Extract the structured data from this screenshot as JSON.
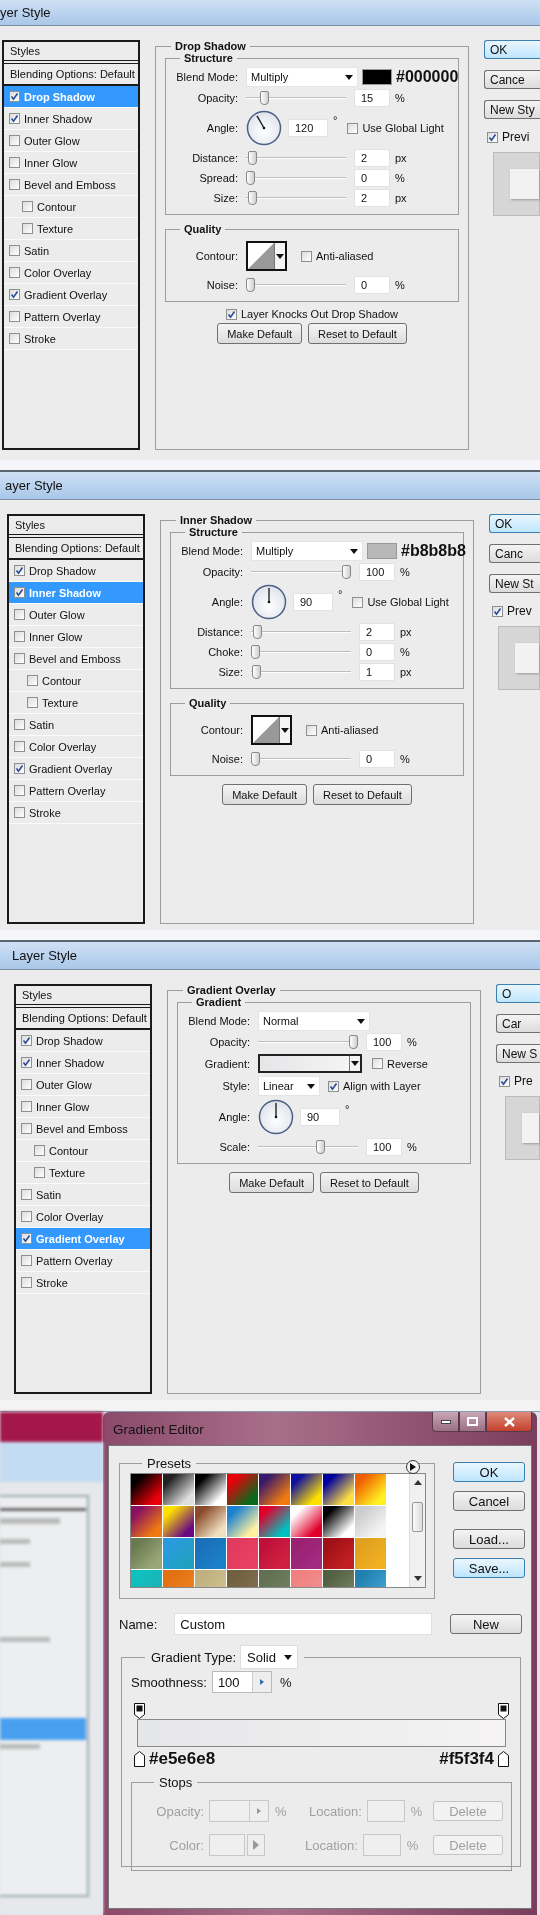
{
  "layer_style_dialogs": [
    {
      "title": "yer Style",
      "styles_list": [
        {
          "kind": "header",
          "label": "Styles",
          "selected": false
        },
        {
          "kind": "option",
          "label": "Blending Options: Default",
          "selected": false
        },
        {
          "kind": "effect",
          "label": "Drop Shadow",
          "checked": true,
          "selected": true
        },
        {
          "kind": "effect",
          "label": "Inner Shadow",
          "checked": true,
          "selected": false
        },
        {
          "kind": "effect",
          "label": "Outer Glow",
          "checked": false,
          "selected": false
        },
        {
          "kind": "effect",
          "label": "Inner Glow",
          "checked": false,
          "selected": false
        },
        {
          "kind": "effect",
          "label": "Bevel and Emboss",
          "checked": false,
          "selected": false,
          "children": [
            {
              "kind": "effect",
              "label": "Contour",
              "checked": false,
              "selected": false
            },
            {
              "kind": "effect",
              "label": "Texture",
              "checked": false,
              "selected": false
            }
          ]
        },
        {
          "kind": "effect",
          "label": "Satin",
          "checked": false,
          "selected": false
        },
        {
          "kind": "effect",
          "label": "Color Overlay",
          "checked": false,
          "selected": false
        },
        {
          "kind": "effect",
          "label": "Gradient Overlay",
          "checked": true,
          "selected": false
        },
        {
          "kind": "effect",
          "label": "Pattern Overlay",
          "checked": false,
          "selected": false
        },
        {
          "kind": "effect",
          "label": "Stroke",
          "checked": false,
          "selected": false
        }
      ],
      "panel": {
        "title": "Drop Shadow",
        "groups": [
          {
            "title": "Structure",
            "rows": [
              {
                "kind": "select",
                "label": "Blend Mode:",
                "value": "Multiply",
                "swatch": {
                  "color": "#000000",
                  "hex": "#000000"
                }
              },
              {
                "kind": "slider",
                "label": "Opacity:",
                "level": 0.15,
                "value": "15",
                "unit": "%"
              },
              {
                "kind": "angle",
                "label": "Angle:",
                "value": "120",
                "unit": "°",
                "checkbox": {
                  "label": "Use Global Light",
                  "checked": false
                }
              },
              {
                "kind": "slider",
                "label": "Distance:",
                "level": 0.02,
                "value": "2",
                "unit": "px"
              },
              {
                "kind": "slider",
                "label": "Spread:",
                "level": 0,
                "value": "0",
                "unit": "%"
              },
              {
                "kind": "slider",
                "label": "Size:",
                "level": 0.02,
                "value": "2",
                "unit": "px"
              }
            ]
          },
          {
            "title": "Quality",
            "rows": [
              {
                "kind": "contour",
                "label": "Contour:",
                "checkbox": {
                  "label": "Anti-aliased",
                  "checked": false
                }
              },
              {
                "kind": "slider",
                "label": "Noise:",
                "level": 0,
                "value": "0",
                "unit": "%"
              }
            ]
          }
        ],
        "extra_checkbox": {
          "label": "Layer Knocks Out Drop Shadow",
          "checked": true
        },
        "buttons": [
          "Make Default",
          "Reset to Default"
        ]
      },
      "side_buttons": [
        {
          "label": "OK",
          "focused": true
        },
        {
          "label": "Cance",
          "focused": false
        },
        {
          "label": "New Sty",
          "focused": false
        }
      ],
      "preview": {
        "label": "Previ",
        "checked": true
      }
    },
    {
      "title": "ayer Style",
      "styles_list": [
        {
          "kind": "header",
          "label": "Styles",
          "selected": false
        },
        {
          "kind": "option",
          "label": "Blending Options: Default",
          "selected": false
        },
        {
          "kind": "effect",
          "label": "Drop Shadow",
          "checked": true,
          "selected": false
        },
        {
          "kind": "effect",
          "label": "Inner Shadow",
          "checked": true,
          "selected": true
        },
        {
          "kind": "effect",
          "label": "Outer Glow",
          "checked": false,
          "selected": false
        },
        {
          "kind": "effect",
          "label": "Inner Glow",
          "checked": false,
          "selected": false
        },
        {
          "kind": "effect",
          "label": "Bevel and Emboss",
          "checked": false,
          "selected": false,
          "children": [
            {
              "kind": "effect",
              "label": "Contour",
              "checked": false,
              "selected": false
            },
            {
              "kind": "effect",
              "label": "Texture",
              "checked": false,
              "selected": false
            }
          ]
        },
        {
          "kind": "effect",
          "label": "Satin",
          "checked": false,
          "selected": false
        },
        {
          "kind": "effect",
          "label": "Color Overlay",
          "checked": false,
          "selected": false
        },
        {
          "kind": "effect",
          "label": "Gradient Overlay",
          "checked": true,
          "selected": false
        },
        {
          "kind": "effect",
          "label": "Pattern Overlay",
          "checked": false,
          "selected": false
        },
        {
          "kind": "effect",
          "label": "Stroke",
          "checked": false,
          "selected": false
        }
      ],
      "panel": {
        "title": "Inner Shadow",
        "groups": [
          {
            "title": "Structure",
            "rows": [
              {
                "kind": "select",
                "label": "Blend Mode:",
                "value": "Multiply",
                "swatch": {
                  "color": "#b8b8b8",
                  "hex": "#b8b8b8"
                }
              },
              {
                "kind": "slider",
                "label": "Opacity:",
                "level": 1,
                "value": "100",
                "unit": "%"
              },
              {
                "kind": "angle",
                "label": "Angle:",
                "value": "90",
                "unit": "°",
                "checkbox": {
                  "label": "Use Global Light",
                  "checked": false
                }
              },
              {
                "kind": "slider",
                "label": "Distance:",
                "level": 0.02,
                "value": "2",
                "unit": "px"
              },
              {
                "kind": "slider",
                "label": "Choke:",
                "level": 0,
                "value": "0",
                "unit": "%"
              },
              {
                "kind": "slider",
                "label": "Size:",
                "level": 0.01,
                "value": "1",
                "unit": "px"
              }
            ]
          },
          {
            "title": "Quality",
            "rows": [
              {
                "kind": "contour",
                "label": "Contour:",
                "checkbox": {
                  "label": "Anti-aliased",
                  "checked": false
                }
              },
              {
                "kind": "slider",
                "label": "Noise:",
                "level": 0,
                "value": "0",
                "unit": "%"
              }
            ]
          }
        ],
        "buttons": [
          "Make Default",
          "Reset to Default"
        ]
      },
      "side_buttons": [
        {
          "label": "OK",
          "focused": true
        },
        {
          "label": "Canc",
          "focused": false
        },
        {
          "label": "New St",
          "focused": false
        }
      ],
      "preview": {
        "label": "Prev",
        "checked": true
      }
    },
    {
      "title": "Layer Style",
      "styles_list": [
        {
          "kind": "header",
          "label": "Styles",
          "selected": false
        },
        {
          "kind": "option",
          "label": "Blending Options: Default",
          "selected": false
        },
        {
          "kind": "effect",
          "label": "Drop Shadow",
          "checked": true,
          "selected": false
        },
        {
          "kind": "effect",
          "label": "Inner Shadow",
          "checked": true,
          "selected": false
        },
        {
          "kind": "effect",
          "label": "Outer Glow",
          "checked": false,
          "selected": false
        },
        {
          "kind": "effect",
          "label": "Inner Glow",
          "checked": false,
          "selected": false
        },
        {
          "kind": "effect",
          "label": "Bevel and Emboss",
          "checked": false,
          "selected": false,
          "children": [
            {
              "kind": "effect",
              "label": "Contour",
              "checked": false,
              "selected": false
            },
            {
              "kind": "effect",
              "label": "Texture",
              "checked": false,
              "selected": false
            }
          ]
        },
        {
          "kind": "effect",
          "label": "Satin",
          "checked": false,
          "selected": false
        },
        {
          "kind": "effect",
          "label": "Color Overlay",
          "checked": false,
          "selected": false
        },
        {
          "kind": "effect",
          "label": "Gradient Overlay",
          "checked": true,
          "selected": true
        },
        {
          "kind": "effect",
          "label": "Pattern Overlay",
          "checked": false,
          "selected": false
        },
        {
          "kind": "effect",
          "label": "Stroke",
          "checked": false,
          "selected": false
        }
      ],
      "panel": {
        "title": "Gradient Overlay",
        "groups": [
          {
            "title": "Gradient",
            "rows": [
              {
                "kind": "select",
                "label": "Blend Mode:",
                "value": "Normal"
              },
              {
                "kind": "slider",
                "label": "Opacity:",
                "level": 1,
                "value": "100",
                "unit": "%"
              },
              {
                "kind": "gradient",
                "label": "Gradient:",
                "stops": [
                  {
                    "color": "#e5e6e8"
                  },
                  {
                    "color": "#f5f3f4"
                  }
                ],
                "checkbox": {
                  "label": "Reverse",
                  "checked": false
                }
              },
              {
                "kind": "select",
                "label": "Style:",
                "value": "Linear",
                "checkbox": {
                  "label": "Align with Layer",
                  "checked": true
                }
              },
              {
                "kind": "angle",
                "label": "Angle:",
                "value": "90",
                "unit": "°"
              },
              {
                "kind": "slider",
                "label": "Scale:",
                "level": 0.64,
                "value": "100",
                "unit": "%"
              }
            ]
          }
        ],
        "buttons": [
          "Make Default",
          "Reset to Default"
        ]
      },
      "side_buttons": [
        {
          "label": "O",
          "focused": true
        },
        {
          "label": "Car",
          "focused": false
        },
        {
          "label": "New S",
          "focused": false
        }
      ],
      "preview": {
        "label": "Pre",
        "checked": true
      }
    }
  ],
  "gradient_editor": {
    "title": "Gradient Editor",
    "presets": {
      "title": "Presets"
    },
    "buttons": [
      {
        "label": "OK",
        "focused": true
      },
      {
        "label": "Cancel",
        "focused": false
      },
      {
        "label": "Load...",
        "focused": false
      },
      {
        "label": "Save...",
        "focused": true
      }
    ],
    "name": {
      "label": "Name:",
      "value": "Custom",
      "button": "New"
    },
    "gradient_type": {
      "label": "Gradient Type:",
      "value": "Solid"
    },
    "smoothness": {
      "label": "Smoothness:",
      "value": "100",
      "unit": "%"
    },
    "color_stops": [
      {
        "hex": "#e5e6e8"
      },
      {
        "hex": "#f5f3f4"
      }
    ],
    "stops": {
      "title": "Stops",
      "rows": [
        {
          "kind": "opacity",
          "label": "Opacity:",
          "unit": "%",
          "location_label": "Location:",
          "location_unit": "%",
          "button": "Delete",
          "disabled": true
        },
        {
          "kind": "color",
          "label": "Color:",
          "location_label": "Location:",
          "location_unit": "%",
          "button": "Delete",
          "disabled": true
        }
      ]
    }
  }
}
